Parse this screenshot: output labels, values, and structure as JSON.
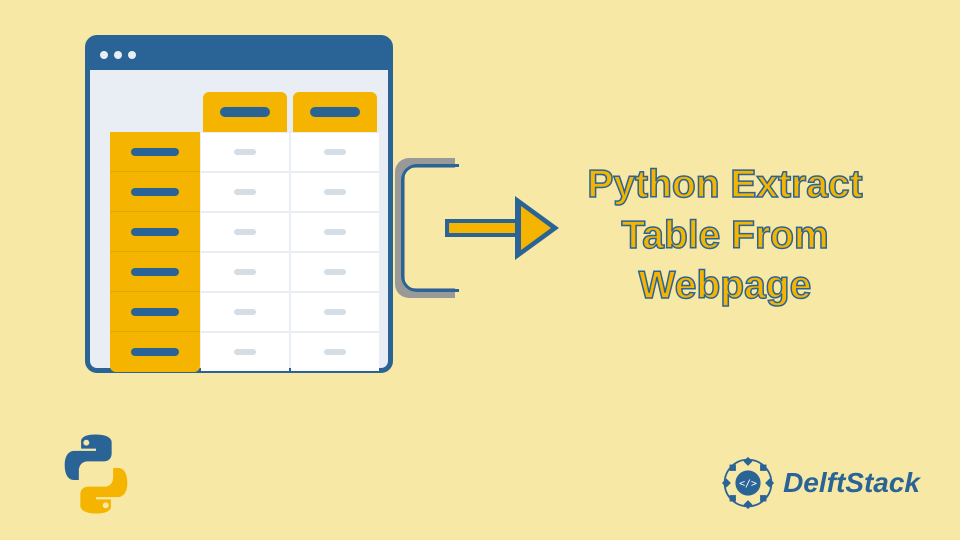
{
  "title_line1": "Python Extract",
  "title_line2": "Table From",
  "title_line3": "Webpage",
  "brand_text": "DelftStack",
  "colors": {
    "background": "#f8e8a6",
    "primary_blue": "#2a6496",
    "accent_yellow": "#f5b400",
    "light_gray": "#e8eef3"
  },
  "icons": {
    "python": "python-logo",
    "brand": "delftstack-logo",
    "arrow": "export-arrow",
    "bracket": "open-bracket"
  }
}
